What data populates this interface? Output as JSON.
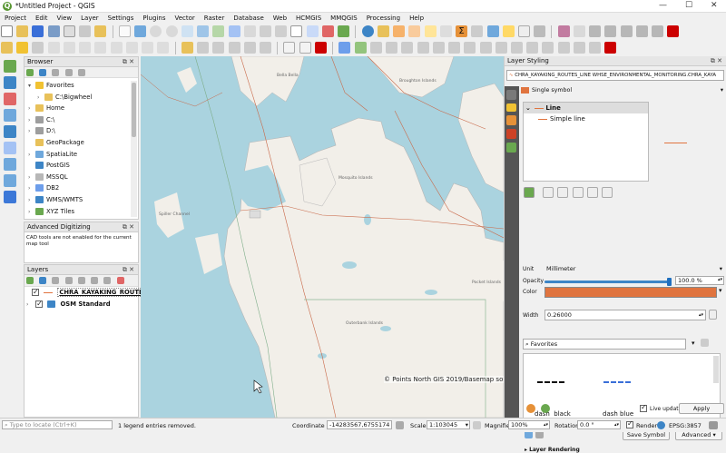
{
  "window": {
    "title": "*Untitled Project - QGIS",
    "minimize": "—",
    "maximize": "☐",
    "close": "✕"
  },
  "menu": [
    "Project",
    "Edit",
    "View",
    "Layer",
    "Settings",
    "Plugins",
    "Vector",
    "Raster",
    "Database",
    "Web",
    "HCMGIS",
    "MMQGIS",
    "Processing",
    "Help"
  ],
  "browser": {
    "title": "Browser",
    "items": [
      {
        "label": "Favorites",
        "icon": "star-icon",
        "indent": 1,
        "arrow": "▾"
      },
      {
        "label": "C:\\Bigwheel",
        "icon": "folder-icon",
        "indent": 2,
        "arrow": "›"
      },
      {
        "label": "Home",
        "icon": "folder-icon",
        "indent": 1,
        "arrow": "›"
      },
      {
        "label": "C:\\",
        "icon": "drive-icon",
        "indent": 1,
        "arrow": "›"
      },
      {
        "label": "D:\\",
        "icon": "drive-icon",
        "indent": 1,
        "arrow": "›"
      },
      {
        "label": "GeoPackage",
        "icon": "geopackage-icon",
        "indent": 1,
        "arrow": ""
      },
      {
        "label": "SpatiaLite",
        "icon": "spatialite-icon",
        "indent": 1,
        "arrow": "›"
      },
      {
        "label": "PostGIS",
        "icon": "postgis-icon",
        "indent": 1,
        "arrow": ""
      },
      {
        "label": "MSSQL",
        "icon": "mssql-icon",
        "indent": 1,
        "arrow": "›"
      },
      {
        "label": "DB2",
        "icon": "db2-icon",
        "indent": 1,
        "arrow": "›"
      },
      {
        "label": "WMS/WMTS",
        "icon": "wms-icon",
        "indent": 1,
        "arrow": "›"
      },
      {
        "label": "XYZ Tiles",
        "icon": "xyz-icon",
        "indent": 1,
        "arrow": "›"
      }
    ]
  },
  "digitizing": {
    "title": "Advanced Digitizing",
    "message": "CAD tools are not enabled for the current map tool"
  },
  "layers": {
    "title": "Layers",
    "items": [
      {
        "label": "CHRA_KAYAKING_ROUTE...",
        "selected": true
      },
      {
        "label": "OSM Standard",
        "selected": false
      }
    ]
  },
  "map": {
    "labels": [
      "Bella Bella",
      "Broughton Islands",
      "Mosquito Islands",
      "Spiller Channel",
      "Outerbank Islands",
      "Pocket Islands"
    ],
    "attribution": "© Points North GIS 2019/Basemap sou"
  },
  "styling": {
    "title": "Layer Styling",
    "layer_select": "CHRA_KAYAKING_ROUTES_LINE WHSE_ENVIRONMENTAL_MONITORING.CHRA_KAYA",
    "renderer": "Single symbol",
    "tree": {
      "root": "Line",
      "child": "Simple line"
    },
    "unit_label": "Unit",
    "unit_value": "Millimeter",
    "opacity_label": "Opacity",
    "opacity_value": "100.0 %",
    "opacity_fraction": 1.0,
    "color_label": "Color",
    "color_hex": "#e0743f",
    "width_label": "Width",
    "width_value": "0.26000",
    "favorites_placeholder": "Favorites",
    "symbols": [
      {
        "name": "dash  black",
        "color": "#111111"
      },
      {
        "name": "dash blue",
        "color": "#3a6fd8"
      }
    ],
    "save_symbol": "Save Symbol",
    "advanced": "Advanced",
    "layer_rendering": "Layer Rendering",
    "live_update": "Live update",
    "apply": "Apply"
  },
  "status": {
    "locate_placeholder": "Type to locate (Ctrl+K)",
    "message": "1 legend entries removed.",
    "coordinate_label": "Coordinate",
    "coordinate": "-14283567,6755174",
    "scale_label": "Scale",
    "scale": "1:103045",
    "magnifier_label": "Magnifier",
    "magnifier": "100%",
    "rotation_label": "Rotation",
    "rotation": "0.0 °",
    "render_label": "Render",
    "crs": "EPSG:3857"
  }
}
